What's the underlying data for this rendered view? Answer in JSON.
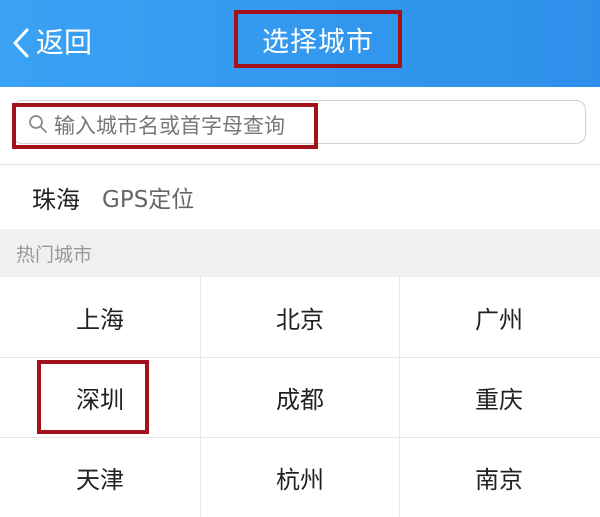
{
  "header": {
    "back_label": "返回",
    "back_icon": "chevron-left-icon",
    "title": "选择城市"
  },
  "search": {
    "icon": "search-icon",
    "placeholder": "输入城市名或首字母查询",
    "value": ""
  },
  "location": {
    "current_city": "珠海",
    "gps_label": "GPS定位"
  },
  "hot_cities": {
    "title": "热门城市",
    "cities": [
      [
        "上海",
        "北京",
        "广州"
      ],
      [
        "深圳",
        "成都",
        "重庆"
      ],
      [
        "天津",
        "杭州",
        "南京"
      ]
    ]
  },
  "colors": {
    "header_start": "#3aa2f5",
    "header_end": "#2d8fe9",
    "highlight_border": "#a3111a",
    "section_bg": "#f0f0f0"
  }
}
